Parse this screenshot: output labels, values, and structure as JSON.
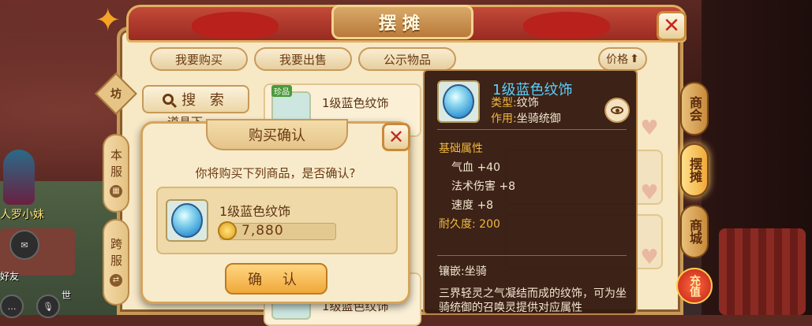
{
  "window": {
    "title": "摆摊"
  },
  "tabs": [
    "我要购买",
    "我要出售",
    "公示物品"
  ],
  "sort": {
    "label": "价格",
    "arrow": "⬆"
  },
  "side_tabs": {
    "shop": "坊",
    "local": "本服",
    "cross": "跨服"
  },
  "search": {
    "label": "搜 索",
    "sub_label": "道具下"
  },
  "list_items": [
    {
      "name": "1级蓝色纹饰",
      "tag": "珍品"
    },
    {
      "name": "1级蓝色纹饰"
    }
  ],
  "right_menu": [
    "商会",
    "摆摊",
    "商城",
    "充值"
  ],
  "world": {
    "npc_name": "人罗小妹",
    "friend_label": "好友",
    "chat_label": "世"
  },
  "dialog": {
    "title": "购买确认",
    "question": "你将购买下列商品，是否确认?",
    "item_name": "1级蓝色纹饰",
    "price": "7,880",
    "confirm_label": "确 认",
    "close_label": "✕"
  },
  "tooltip": {
    "name": "1级蓝色纹饰",
    "type_label": "类型:",
    "type_value": "纹饰",
    "use_label": "作用:",
    "use_value": "坐骑统御",
    "base_section": "基础属性",
    "attrs": [
      {
        "name": "气血",
        "value": "+40"
      },
      {
        "name": "法术伤害",
        "value": "+8"
      },
      {
        "name": "速度",
        "value": "+8"
      }
    ],
    "durability": "耐久度: 200",
    "inlay": "镶嵌:坐骑",
    "description": "三界轻灵之气凝结而成的纹饰，可为坐骑统御的召唤灵提供对应属性"
  },
  "colors": {
    "panel_bg": "#f7e8c6",
    "accent_red": "#c0281e",
    "tooltip_bg": "#341a10",
    "item_name_blue": "#5ad0ff",
    "label_gold": "#f0b840"
  },
  "icons": [
    "close-icon",
    "search-icon",
    "coin-icon",
    "eye-icon",
    "heart-icon",
    "orb-icon",
    "sort-arrow-icon"
  ]
}
